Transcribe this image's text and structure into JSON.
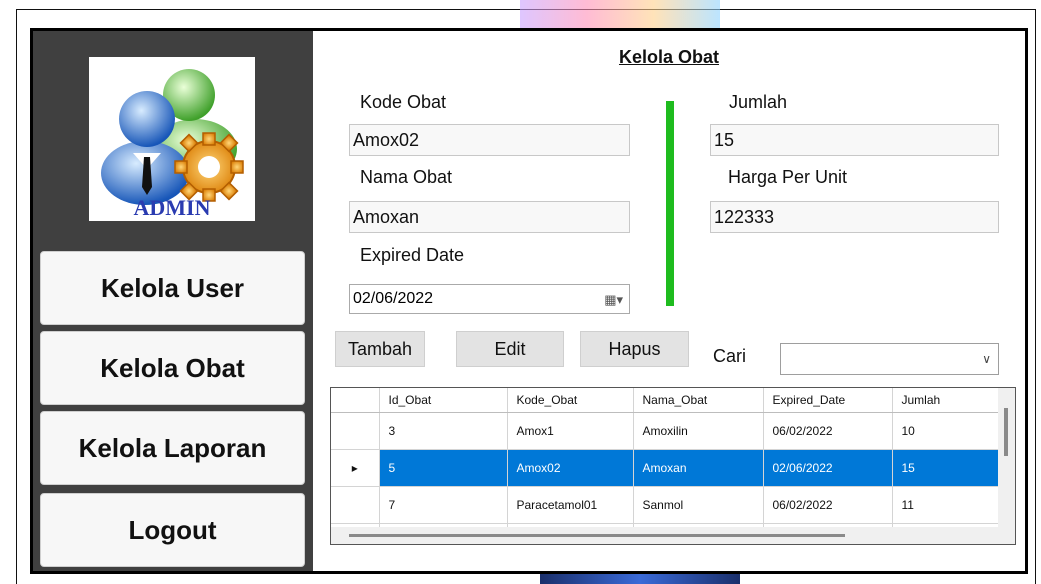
{
  "sidebar": {
    "logo_text": "ADMIN",
    "buttons": [
      {
        "label": "Kelola User"
      },
      {
        "label": "Kelola Obat"
      },
      {
        "label": "Kelola Laporan"
      },
      {
        "label": "Logout"
      }
    ]
  },
  "main": {
    "title": "Kelola Obat",
    "form": {
      "kode_obat_label": "Kode Obat",
      "kode_obat_value": "Amox02",
      "nama_obat_label": "Nama Obat",
      "nama_obat_value": "Amoxan",
      "expired_date_label": "Expired Date",
      "expired_date_value": "02/06/2022",
      "jumlah_label": "Jumlah",
      "jumlah_value": "15",
      "harga_label": "Harga Per Unit",
      "harga_value": "122333"
    },
    "actions": {
      "tambah": "Tambah",
      "edit": "Edit",
      "hapus": "Hapus",
      "cari_label": "Cari",
      "cari_value": ""
    },
    "grid": {
      "columns": [
        "Id_Obat",
        "Kode_Obat",
        "Nama_Obat",
        "Expired_Date",
        "Jumlah"
      ],
      "rows": [
        {
          "indicator": "",
          "cells": [
            "3",
            "Amox1",
            "Amoxilin",
            "06/02/2022",
            "10"
          ]
        },
        {
          "indicator": "▸",
          "cells": [
            "5",
            "Amox02",
            "Amoxan",
            "02/06/2022",
            "15"
          ]
        },
        {
          "indicator": "",
          "cells": [
            "7",
            "Paracetamol01",
            "Sanmol",
            "06/02/2022",
            "11"
          ]
        }
      ],
      "new_row_indicator": "*"
    }
  },
  "colors": {
    "sidebar_bg": "#404040",
    "divider": "#1ebc1e",
    "selection": "#0078d7"
  },
  "icons": {
    "date_picker": "calendar-dropdown-icon",
    "combo": "chevron-down-icon",
    "logo": "admin-users-gear-icon"
  }
}
